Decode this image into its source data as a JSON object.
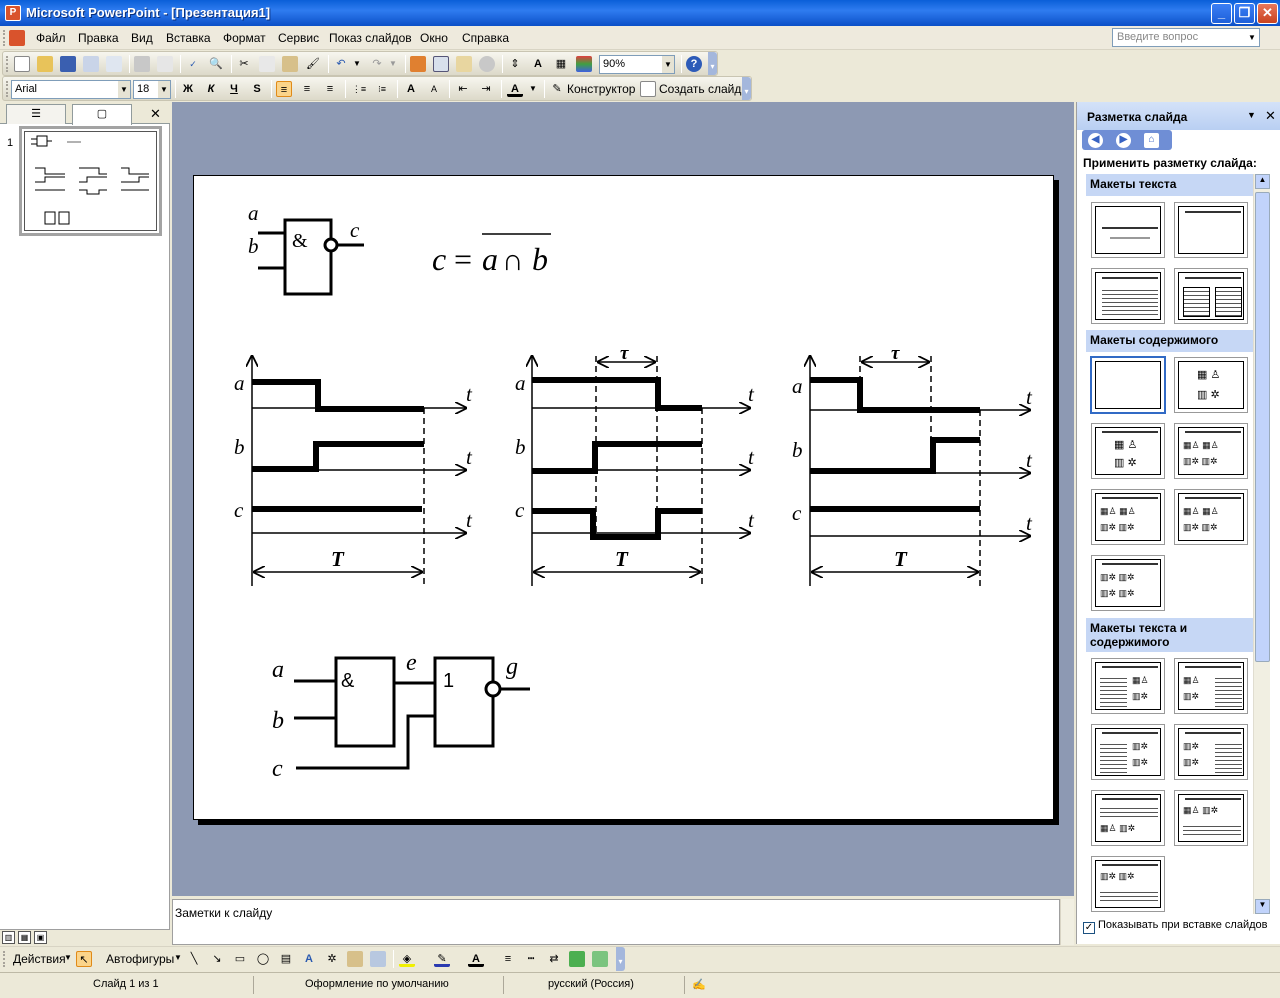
{
  "window": {
    "title": "Microsoft PowerPoint - [Презентация1]",
    "minimize_icon": "minimize-icon",
    "maximize_icon": "restore-icon",
    "close_icon": "close-icon"
  },
  "menu": {
    "items": [
      "Файл",
      "Правка",
      "Вид",
      "Вставка",
      "Формат",
      "Сервис",
      "Показ слайдов",
      "Окно",
      "Справка"
    ],
    "ask_placeholder": "Введите вопрос"
  },
  "standard_toolbar": {
    "zoom": "90%"
  },
  "formatting_toolbar": {
    "font": "Arial",
    "size": "18",
    "bold": "Ж",
    "italic": "К",
    "underline": "Ч",
    "shadow": "S",
    "designer": "Конструктор",
    "new_slide": "Создать слайд"
  },
  "left_pane": {
    "slide_number": "1"
  },
  "notes": {
    "placeholder": "Заметки к слайду"
  },
  "task_pane": {
    "title": "Разметка слайда",
    "apply_label": "Применить разметку слайда:",
    "sections": [
      "Макеты текста",
      "Макеты содержимого",
      "Макеты текста и содержимого"
    ],
    "show_on_insert": "Показывать при вставке слайдов"
  },
  "draw_toolbar": {
    "actions": "Действия",
    "autoshapes": "Автофигуры"
  },
  "status": {
    "slide": "Слайд 1 из 1",
    "design": "Оформление по умолчанию",
    "language": "русский (Россия)"
  },
  "slide": {
    "gate1": {
      "in_a": "a",
      "in_b": "b",
      "out": "c",
      "symbol": "&"
    },
    "formula": {
      "lhs": "c",
      "eq": "=",
      "rhs_a": "a",
      "op": "∩",
      "rhs_b": "b"
    },
    "diagrams": {
      "signal_a": "a",
      "signal_b": "b",
      "signal_c": "c",
      "time": "t",
      "period": "T",
      "delay": "τ"
    },
    "circuit2": {
      "in_a": "a",
      "in_b": "b",
      "in_c": "c",
      "mid": "e",
      "out": "g",
      "and_symbol": "&",
      "or_symbol": "1"
    }
  }
}
